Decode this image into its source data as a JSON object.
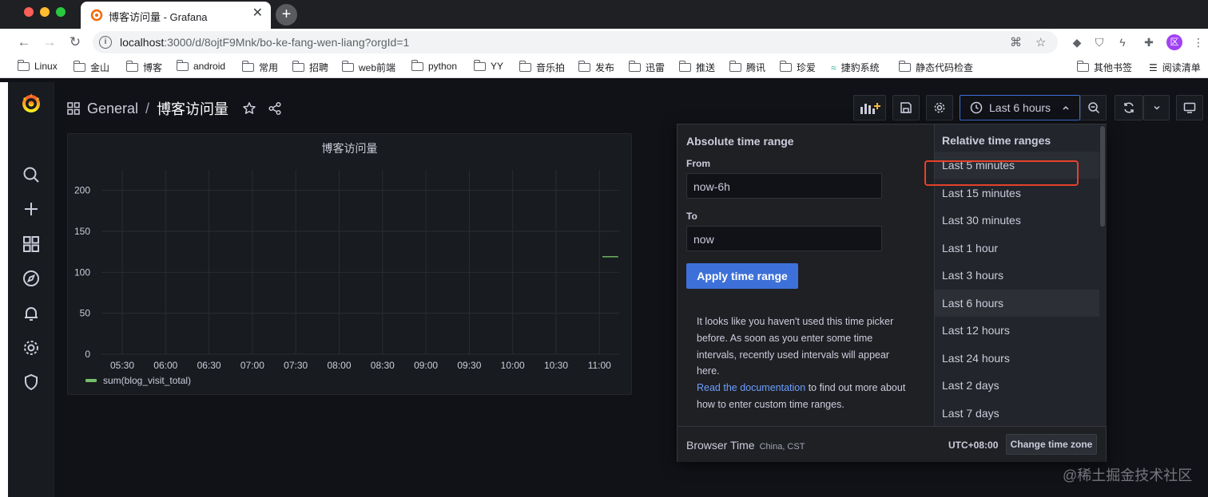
{
  "browser": {
    "tab_title": "博客访问量 - Grafana",
    "tab_close": "✕",
    "new_tab": "+",
    "url_host": "localhost",
    "url_path": ":3000/d/8ojtF9Mnk/bo-ke-fang-wen-liang?orgId=1",
    "profile_initial": "区",
    "bookmarks": [
      "Linux",
      "金山",
      "博客",
      "android",
      "常用",
      "招聘",
      "web前端",
      "python",
      "YY",
      "音乐拍",
      "发布",
      "迅雷",
      "推送",
      "腾讯",
      "珍爱",
      "捷豹系统",
      "静态代码检查"
    ],
    "other_bookmarks": "其他书签",
    "reading_list": "阅读清单"
  },
  "dashboard": {
    "folder": "General",
    "separator": "/",
    "title": "博客访问量",
    "time_picker_label": "Last 6 hours"
  },
  "panel": {
    "title": "博客访问量",
    "legend": "sum(blog_visit_total)"
  },
  "chart_data": {
    "type": "line",
    "title": "博客访问量",
    "x": [
      "05:30",
      "06:00",
      "06:30",
      "07:00",
      "07:30",
      "08:00",
      "08:30",
      "09:00",
      "09:30",
      "10:00",
      "10:30",
      "11:00"
    ],
    "yticks": [
      0,
      50,
      100,
      150,
      200
    ],
    "ylim": [
      0,
      225
    ],
    "series": [
      {
        "name": "sum(blog_visit_total)",
        "color": "#73bf69",
        "points": [
          [
            "11:02",
            119
          ],
          [
            "11:13",
            119
          ]
        ]
      }
    ],
    "grid": true,
    "legend_position": "bottom-left"
  },
  "time_picker": {
    "absolute_title": "Absolute time range",
    "from_label": "From",
    "from_value": "now-6h",
    "to_label": "To",
    "to_value": "now",
    "apply_label": "Apply time range",
    "hint_text": "It looks like you haven't used this time picker before. As soon as you enter some time intervals, recently used intervals will appear here.",
    "doc_link": "Read the documentation",
    "doc_text": " to find out more about how to enter custom time ranges.",
    "relative_title": "Relative time ranges",
    "relative_items": [
      "Last 5 minutes",
      "Last 15 minutes",
      "Last 30 minutes",
      "Last 1 hour",
      "Last 3 hours",
      "Last 6 hours",
      "Last 12 hours",
      "Last 24 hours",
      "Last 2 days",
      "Last 7 days"
    ],
    "selected": "Last 6 hours",
    "browser_time_label": "Browser Time",
    "browser_time_zone": "China, CST",
    "utc_offset": "UTC+08:00",
    "change_tz_label": "Change time zone"
  },
  "watermark": "@稀土掘金技术社区",
  "colors": {
    "accent": "#3d71d9",
    "series": "#73bf69",
    "highlight": "#e6412b"
  }
}
